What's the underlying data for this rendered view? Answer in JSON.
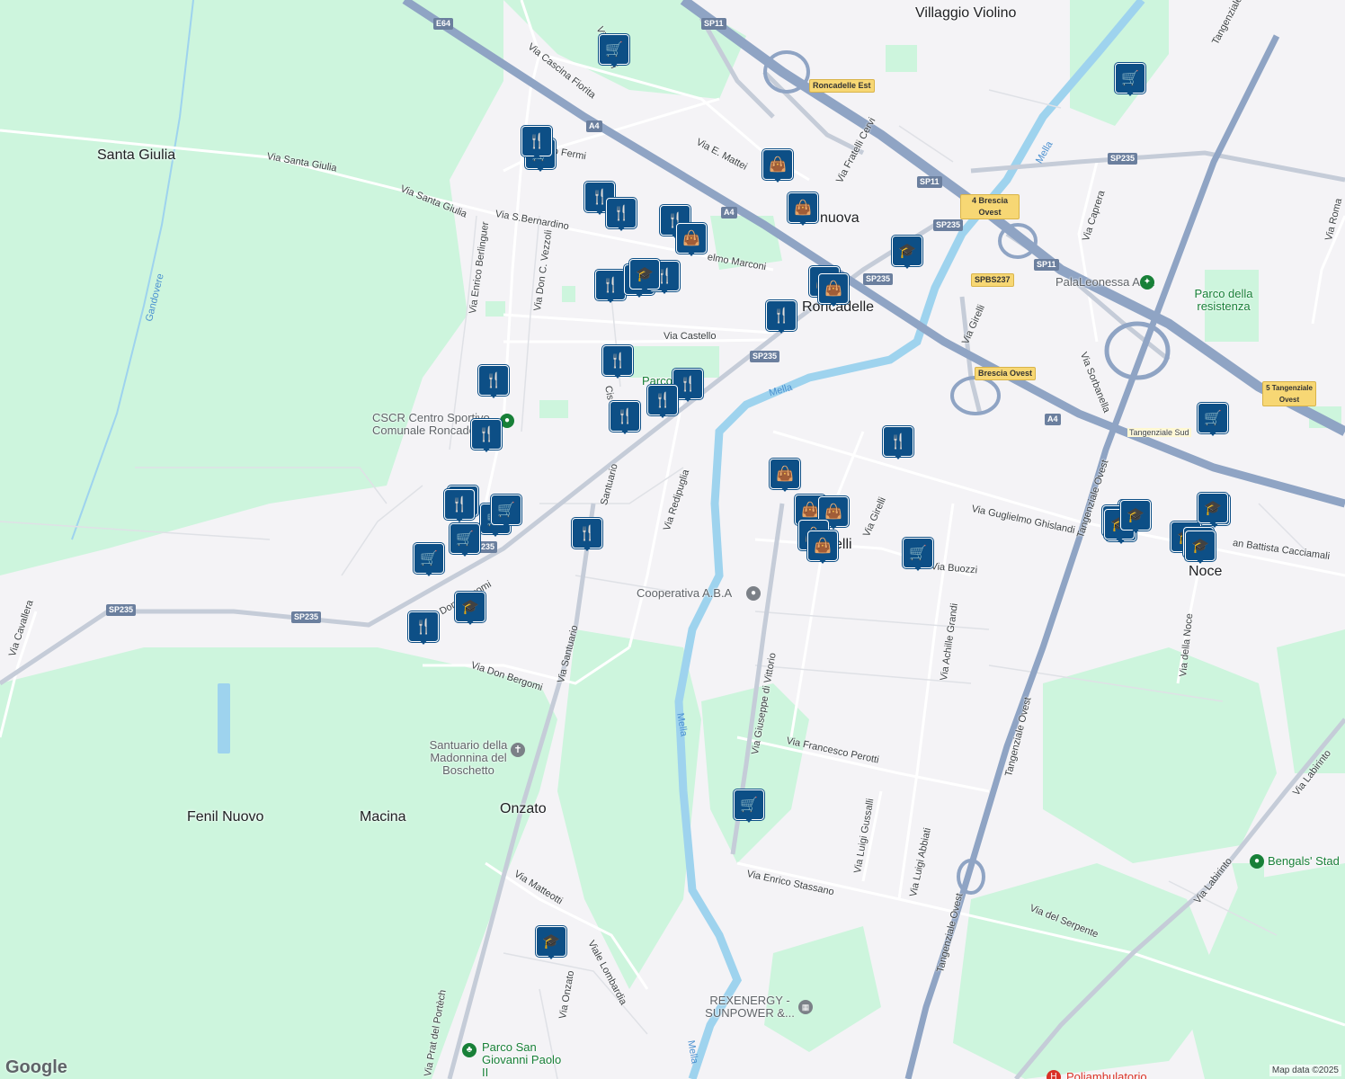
{
  "map": {
    "attribution": "Map data ©2025",
    "logo": "Google",
    "colors": {
      "background": "#f4f3f6",
      "green": "#cdf5dd",
      "water": "#9ed3ee",
      "highway": "#8fa4c4",
      "marker": "#0d4f86"
    }
  },
  "towns": [
    "Villaggio Violino",
    "Santa Giulia",
    "Roncadelle",
    "Noce",
    "Fenil Nuovo",
    "Macina",
    "Onzato",
    "nuova",
    "elli"
  ],
  "streets": [
    "Via Mattei",
    "Via Cascina Fiorita",
    "Via E. Mattei",
    "Via Fratelli Cervi",
    "Via Santa Giulia",
    "Via Santa Giulia",
    "Via S.Bernardino",
    "Via Enrico Berlinguer",
    "Via Don C. Vezzoli",
    "o Fermi",
    "Via Castello",
    "elmo Marconi",
    "Via Redipuglia",
    "Santuario",
    "Cis",
    "Via Santuario",
    "Via Don Bergomi",
    "Don Bergomi",
    "Via Matteotti",
    "Viale Lombardia",
    "Via Onzato",
    "Via Prat del Portèch",
    "Via Cavallera",
    "Via Giuseppe di Vittorio",
    "Via Francesco Perotti",
    "Via Luigi Gussalli",
    "Via Luigi Abbiati",
    "Via Enrico Stassano",
    "Via Achille Grandi",
    "Via Girelli",
    "Via Girelli",
    "Via Guglielmo Ghislandi",
    "Via Buozzi",
    "Via Caprera",
    "Via Sorbanella",
    "Via Roma",
    "Via della Noce",
    "Via Labirinto",
    "Via Labirinto",
    "Via del Serpente",
    "Tangenziale Ovest",
    "Tangenziale Ovest",
    "Tangenziale Ovest",
    "Tangenziale Ovest",
    "an Battista Cacciamali",
    "Vi"
  ],
  "waters": [
    "Mella",
    "Mella",
    "Mella",
    "Mella",
    "Gandovere"
  ],
  "pois": [
    "PalaLeonessa A2A",
    "Parco della resistenza",
    "CSCR Centro Sportivo Comunale Roncadelle",
    "Cooperativa A.B.A",
    "Santuario della Madonnina del Boschetto",
    "REXENERGY - SUNPOWER &...",
    "Parco San Giovanni Paolo II",
    "Bengals' Stad",
    "Poliambulatorio",
    "Parco",
    "Tangenziale Sud"
  ],
  "shields": [
    "E64",
    "SP11",
    "A4",
    "A4",
    "Roncadelle Est",
    "SP11",
    "SP235",
    "SP235",
    "SP235",
    "SP235",
    "SP235",
    "SP235",
    "SPBS237",
    "4 Brescia Ovest",
    "SP11",
    "A4",
    "Brescia Ovest",
    "SP235",
    "5 Tangenziale Ovest"
  ],
  "markers": [
    "cart",
    "cart",
    "cart",
    "cart",
    "cart",
    "cart",
    "cart",
    "cart",
    "cart",
    "cart",
    "cart",
    "fork",
    "fork",
    "fork",
    "fork",
    "fork",
    "fork",
    "fork",
    "fork",
    "fork",
    "fork",
    "fork",
    "fork",
    "fork",
    "fork",
    "fork",
    "fork",
    "fork",
    "fork",
    "school",
    "school",
    "school",
    "school",
    "school",
    "school",
    "school",
    "school",
    "school",
    "school",
    "school",
    "school",
    "school",
    "school",
    "bag",
    "bag",
    "bag",
    "bag",
    "bag",
    "bag",
    "bag",
    "bag",
    "bag",
    "bag"
  ]
}
